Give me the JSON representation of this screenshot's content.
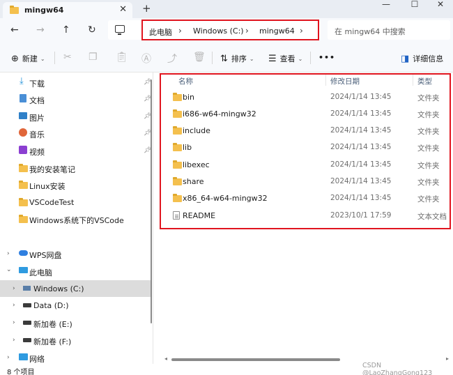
{
  "window": {
    "tab_title": "mingw64",
    "close_glyph": "✕",
    "new_tab_glyph": "+",
    "minimize_glyph": "—",
    "maximize_glyph": "☐",
    "close_window_glyph": "✕"
  },
  "nav": {
    "back_glyph": "←",
    "forward_glyph": "→",
    "up_glyph": "↑",
    "refresh_glyph": "↻"
  },
  "breadcrumb": {
    "items": [
      "此电脑",
      "Windows (C:)",
      "mingw64"
    ],
    "separator": "›"
  },
  "search": {
    "placeholder": "在 mingw64 中搜索"
  },
  "toolbar": {
    "new_label": "新建",
    "sort_label": "排序",
    "view_label": "查看",
    "more_glyph": "•••",
    "details_label": "详细信息"
  },
  "sidebar": {
    "quick_access": [
      {
        "label": "下载",
        "icon": "download-icon"
      },
      {
        "label": "文档",
        "icon": "document-icon"
      },
      {
        "label": "图片",
        "icon": "picture-icon"
      },
      {
        "label": "音乐",
        "icon": "music-icon"
      },
      {
        "label": "视频",
        "icon": "video-icon"
      },
      {
        "label": "我的安装笔记",
        "icon": "folder-icon"
      },
      {
        "label": "Linux安装",
        "icon": "folder-icon"
      },
      {
        "label": "VSCodeTest",
        "icon": "folder-icon"
      },
      {
        "label": "Windows系统下的VSCode",
        "icon": "folder-icon"
      }
    ],
    "wps": "WPS网盘",
    "this_pc": "此电脑",
    "drives": [
      "Windows (C:)",
      "Data (D:)",
      "新加卷 (E:)",
      "新加卷 (F:)"
    ],
    "network": "网络"
  },
  "columns": {
    "name": "名称",
    "date": "修改日期",
    "type": "类型"
  },
  "files": [
    {
      "name": "bin",
      "date": "2024/1/14 13:45",
      "type": "文件夹",
      "kind": "folder"
    },
    {
      "name": "i686-w64-mingw32",
      "date": "2024/1/14 13:45",
      "type": "文件夹",
      "kind": "folder"
    },
    {
      "name": "include",
      "date": "2024/1/14 13:45",
      "type": "文件夹",
      "kind": "folder"
    },
    {
      "name": "lib",
      "date": "2024/1/14 13:45",
      "type": "文件夹",
      "kind": "folder"
    },
    {
      "name": "libexec",
      "date": "2024/1/14 13:45",
      "type": "文件夹",
      "kind": "folder"
    },
    {
      "name": "share",
      "date": "2024/1/14 13:45",
      "type": "文件夹",
      "kind": "folder"
    },
    {
      "name": "x86_64-w64-mingw32",
      "date": "2024/1/14 13:45",
      "type": "文件夹",
      "kind": "folder"
    },
    {
      "name": "README",
      "date": "2023/10/1 17:59",
      "type": "文本文档",
      "kind": "text"
    }
  ],
  "status": {
    "item_count": "8 个项目"
  },
  "watermark": "CSDN @LaoZhangGong123",
  "colors": {
    "highlight_box": "#e0141e",
    "folder": "#f4c04e",
    "selected_nav": "#dcdcdc"
  }
}
